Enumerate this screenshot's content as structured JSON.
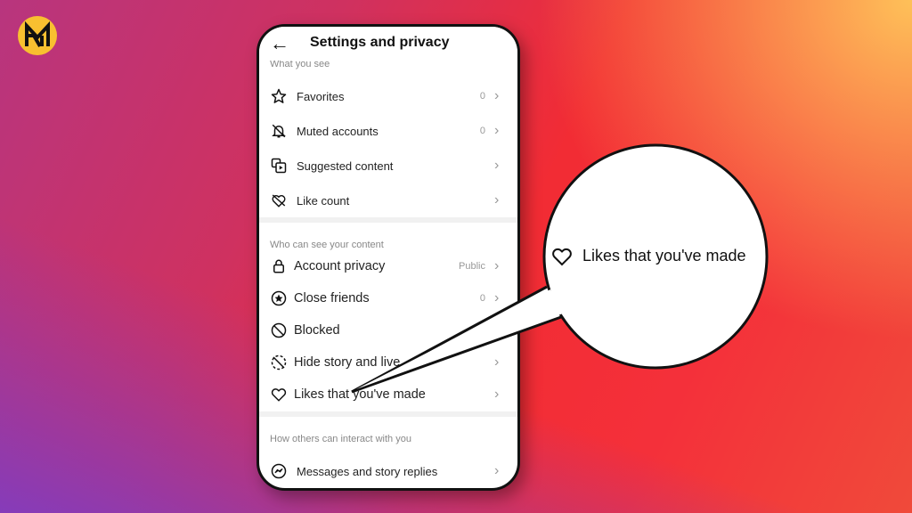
{
  "logo": {
    "text": "RM",
    "color": "#f8c030"
  },
  "header": {
    "back_icon": "arrow-left-icon",
    "title": "Settings and privacy"
  },
  "sections": [
    {
      "title": "What you see",
      "items": [
        {
          "label": "Favorites",
          "value": "0",
          "icon": "star-icon"
        },
        {
          "label": "Muted accounts",
          "value": "0",
          "icon": "bell-off-icon"
        },
        {
          "label": "Suggested content",
          "value": "",
          "icon": "suggested-content-icon"
        },
        {
          "label": "Like count",
          "value": "",
          "icon": "heart-off-icon"
        }
      ]
    },
    {
      "title": "Who can see your content",
      "items": [
        {
          "label": "Account privacy",
          "value": "Public",
          "icon": "lock-icon"
        },
        {
          "label": "Close friends",
          "value": "0",
          "icon": "star-circle-icon"
        },
        {
          "label": "Blocked",
          "value": "",
          "icon": "blocked-icon"
        },
        {
          "label": "Hide story and live",
          "value": "",
          "icon": "hide-story-icon"
        },
        {
          "label": "Likes that you've made",
          "value": "",
          "icon": "heart-icon"
        }
      ]
    },
    {
      "title": "How others can interact with you",
      "items": [
        {
          "label": "Messages and story replies",
          "value": "",
          "icon": "messenger-icon"
        }
      ]
    }
  ],
  "callout": {
    "label": "Likes that you've made",
    "icon": "heart-icon"
  }
}
